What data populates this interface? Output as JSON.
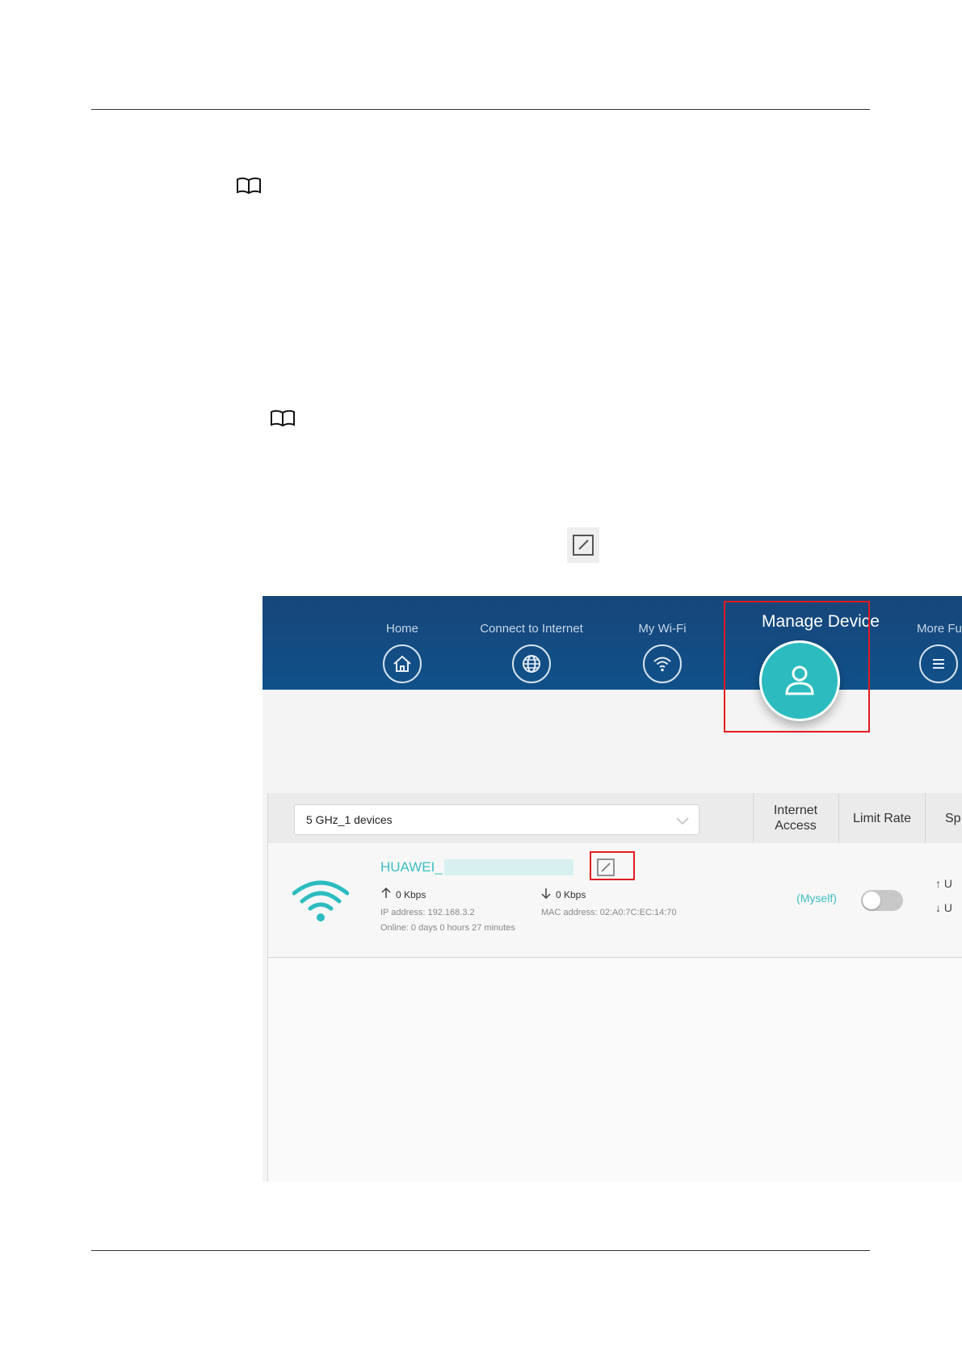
{
  "icons": {
    "note_icon": "book-icon",
    "edit_icon": "edit-icon",
    "home_icon": "home-icon",
    "globe_icon": "globe-icon",
    "wifi_icon": "wifi-icon",
    "user_icon": "user-icon",
    "menu_icon": "menu-icon",
    "chevron_icon": "chevron-down-icon"
  },
  "colors": {
    "nav_background": "#10518a",
    "accent_teal": "#2cbcbf",
    "highlight_red": "#e01b22"
  },
  "screenshot": {
    "nav": {
      "home": "Home",
      "connect": "Connect to Internet",
      "wifi": "My Wi-Fi",
      "manage": "Manage Device",
      "more": "More Functi"
    },
    "table": {
      "band_select": "5 GHz_1 devices",
      "col_internet_access": [
        "Internet",
        "Access"
      ],
      "col_limit_rate": "Limit Rate",
      "col_speed": "Sp",
      "device": {
        "name": "HUAWEI_",
        "upload": "0 Kbps",
        "download": "0 Kbps",
        "ip": "IP address: 192.168.3.2",
        "mac": "MAC address: 02:A0:7C:EC:14:70",
        "online": "Online: 0 days 0 hours 27 minutes",
        "internet_access": "(Myself)",
        "limit_rate_enabled": false,
        "speed_up": "U",
        "speed_down": "U"
      }
    }
  }
}
